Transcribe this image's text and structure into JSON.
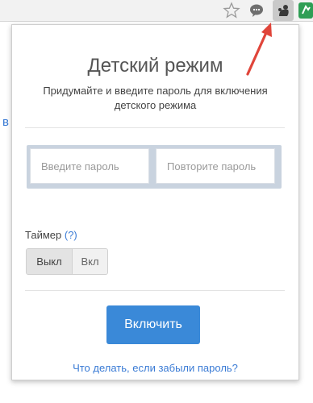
{
  "toolbar": {
    "icons": [
      "star-icon",
      "chat-icon",
      "parental-control-extension-icon",
      "green-extension-icon"
    ]
  },
  "page": {
    "left_letter": "в"
  },
  "popup": {
    "title": "Детский режим",
    "subtitle": "Придумайте и введите пароль для включения детского режима",
    "password_placeholder": "Введите пароль",
    "repeat_placeholder": "Повторите пароль",
    "timer_label": "Таймер",
    "timer_help": "(?)",
    "toggle_off": "Выкл",
    "toggle_on": "Вкл",
    "enable_button": "Включить",
    "forgot_link": "Что делать, если забыли пароль?"
  },
  "colors": {
    "accent": "#3a89d8",
    "link": "#3a7bd5",
    "annotation_arrow": "#e0453a"
  }
}
